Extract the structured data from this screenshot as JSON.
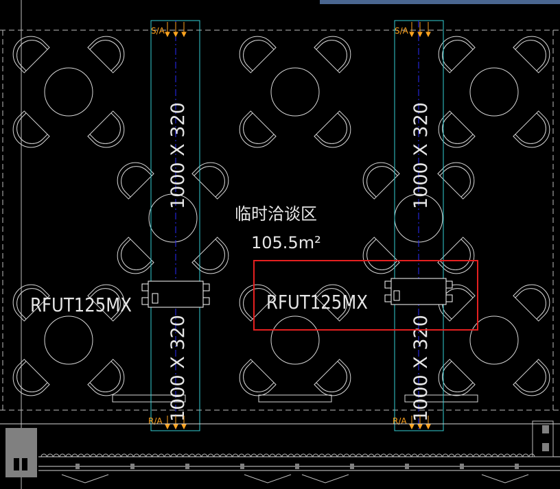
{
  "room": {
    "name": "临时洽谈区",
    "area": "105.5m²"
  },
  "units": {
    "left_model": "RFUT125MX",
    "right_model": "RFUT125MX"
  },
  "ducts": {
    "upper_size": "1000 X 320",
    "lower_size": "1000 X 320",
    "supply_tag": "S/A",
    "return_tag": "R/A"
  },
  "colors": {
    "background": "#000000",
    "furniture": "#d9d9d9",
    "duct_outline": "#35d0d6",
    "duct_centerline": "#2a2cff",
    "unit": "#ffffff",
    "arrows": "#ffa41f",
    "highlight_box": "#e62020",
    "wall_blue": "#4a6690",
    "dashed_boundary": "#bfbfbf"
  },
  "highlight": {
    "label": "selected-unit"
  }
}
